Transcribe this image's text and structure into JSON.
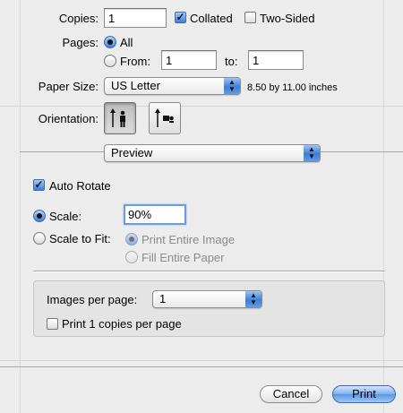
{
  "copies": {
    "label": "Copies:",
    "value": "1",
    "collated_label": "Collated",
    "collated_checked": true,
    "two_sided_label": "Two-Sided",
    "two_sided_checked": false
  },
  "pages": {
    "label": "Pages:",
    "all_label": "All",
    "from_label": "From:",
    "from_value": "1",
    "to_label": "to:",
    "to_value": "1",
    "selected": "all"
  },
  "paper_size": {
    "label": "Paper Size:",
    "value": "US Letter",
    "dimensions": "8.50 by 11.00 inches"
  },
  "orientation": {
    "label": "Orientation:",
    "selected": "portrait",
    "portrait_icon": "portrait-orientation-icon",
    "landscape_icon": "landscape-orientation-icon"
  },
  "section_popup": {
    "value": "Preview"
  },
  "preview": {
    "auto_rotate_label": "Auto Rotate",
    "auto_rotate_checked": true,
    "scale_label": "Scale:",
    "scale_value": "90%",
    "scale_to_fit_label": "Scale to Fit:",
    "scale_mode": "scale",
    "print_entire_image_label": "Print Entire Image",
    "fill_entire_paper_label": "Fill Entire Paper",
    "fit_option": "print_entire_image"
  },
  "images_per_page": {
    "label": "Images per page:",
    "value": "1",
    "print_copies_label": "Print 1 copies per page",
    "print_copies_checked": false
  },
  "buttons": {
    "cancel": "Cancel",
    "print": "Print"
  },
  "colors": {
    "accent": "#3d7fd6",
    "background": "#ececec"
  }
}
